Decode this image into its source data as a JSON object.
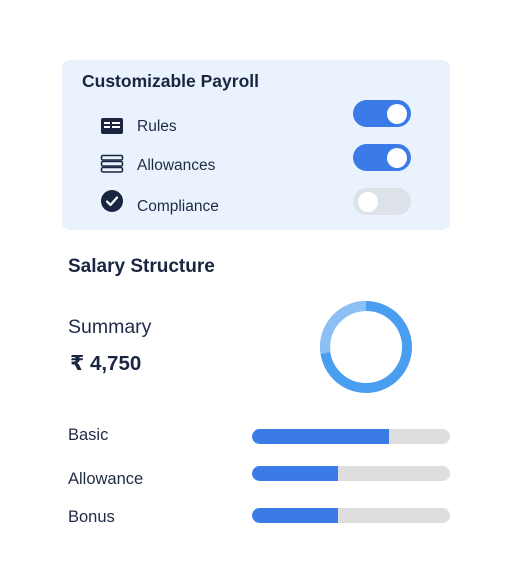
{
  "payroll": {
    "title": "Customizable Payroll",
    "items": [
      {
        "label": "Rules",
        "icon": "id-card-icon",
        "enabled": true
      },
      {
        "label": "Allowances",
        "icon": "stack-icon",
        "enabled": true
      },
      {
        "label": "Compliance",
        "icon": "check-circle-icon",
        "enabled": false
      }
    ]
  },
  "salary": {
    "title": "Salary Structure",
    "summary_label": "Summary",
    "summary_value": "₹ 4,750",
    "breakdown": [
      {
        "label": "Basic",
        "fraction": 0.69
      },
      {
        "label": "Allowance",
        "fraction": 0.435
      },
      {
        "label": "Bonus",
        "fraction": 0.435
      }
    ]
  },
  "colors": {
    "accent": "#3a7be8",
    "toggle_off": "#dde2e8",
    "card_bg": "#eaf3fd",
    "donut_main": "#4a9ef0",
    "donut_light": "#8cc0f5",
    "track": "#dedede"
  }
}
